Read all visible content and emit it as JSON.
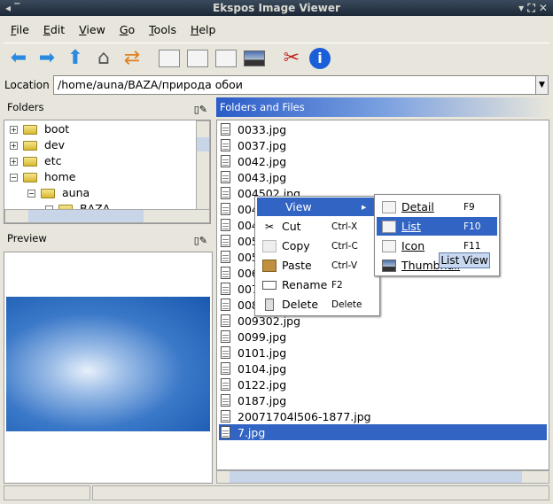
{
  "window": {
    "title": "Ekspos Image Viewer"
  },
  "menubar": [
    "File",
    "Edit",
    "View",
    "Go",
    "Tools",
    "Help"
  ],
  "toolbar": [
    "back-icon",
    "forward-icon",
    "up-icon",
    "home-icon",
    "refresh-icon",
    "detail-view-icon",
    "list-view-icon",
    "icon-view-icon",
    "thumbnail-view-icon",
    "tools-icon",
    "info-icon"
  ],
  "location": {
    "label": "Location",
    "value": "/home/auna/BAZA/природа обои"
  },
  "folders": {
    "title": "Folders",
    "items": [
      {
        "label": "boot",
        "expander": "+"
      },
      {
        "label": "dev",
        "expander": "+"
      },
      {
        "label": "etc",
        "expander": "+"
      },
      {
        "label": "home",
        "expander": "−"
      },
      {
        "label": "auna",
        "expander": "−"
      },
      {
        "label": "BAZA",
        "expander": "−"
      }
    ]
  },
  "preview": {
    "title": "Preview"
  },
  "files": {
    "title": "Folders and Files",
    "items": [
      "0033.jpg",
      "0037.jpg",
      "0042.jpg",
      "0043.jpg",
      "004502.jpg",
      "004",
      "004",
      "005",
      "005",
      "006",
      "007",
      "008",
      "009302.jpg",
      "0099.jpg",
      "0101.jpg",
      "0104.jpg",
      "0122.jpg",
      "0187.jpg",
      "20071704l506-1877.jpg",
      "7.jpg"
    ],
    "selected": "7.jpg"
  },
  "context_menu": [
    {
      "label": "View",
      "shortcut": "▸"
    },
    {
      "label": "Cut",
      "shortcut": "Ctrl-X"
    },
    {
      "label": "Copy",
      "shortcut": "Ctrl-C"
    },
    {
      "label": "Paste",
      "shortcut": "Ctrl-V"
    },
    {
      "label": "Rename",
      "shortcut": "F2"
    },
    {
      "label": "Delete",
      "shortcut": "Delete"
    }
  ],
  "view_submenu": [
    {
      "label": "Detail",
      "shortcut": "F9"
    },
    {
      "label": "List",
      "shortcut": "F10"
    },
    {
      "label": "Icon",
      "shortcut": "F11"
    },
    {
      "label": "Thumbnail",
      "shortcut": ""
    }
  ],
  "tooltip": "List View"
}
